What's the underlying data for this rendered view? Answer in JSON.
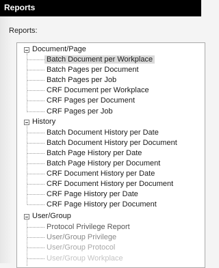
{
  "window": {
    "title": "Reports"
  },
  "reports_label": "Reports:",
  "tree": {
    "groups": [
      {
        "label": "Document/Page",
        "items": [
          "Batch Document per Workplace",
          "Batch Pages per Document",
          "Batch Pages per Job",
          "CRF Document per Workplace",
          "CRF Pages per Document",
          "CRF Pages per Job"
        ]
      },
      {
        "label": "History",
        "items": [
          "Batch Document History per Date",
          "Batch Document History per Document",
          "Batch Page History per Date",
          "Batch Page History per Document",
          "CRF Document History per Date",
          "CRF Document History per Document",
          "CRF Page History per Date",
          "CRF Page History per Document"
        ]
      },
      {
        "label": "User/Group",
        "items": [
          "Protocol Privilege Report",
          "User/Group Privilege",
          "User/Group Protocol",
          "User/Group Workplace"
        ]
      }
    ],
    "selected_item": "Batch Document per Workplace"
  }
}
